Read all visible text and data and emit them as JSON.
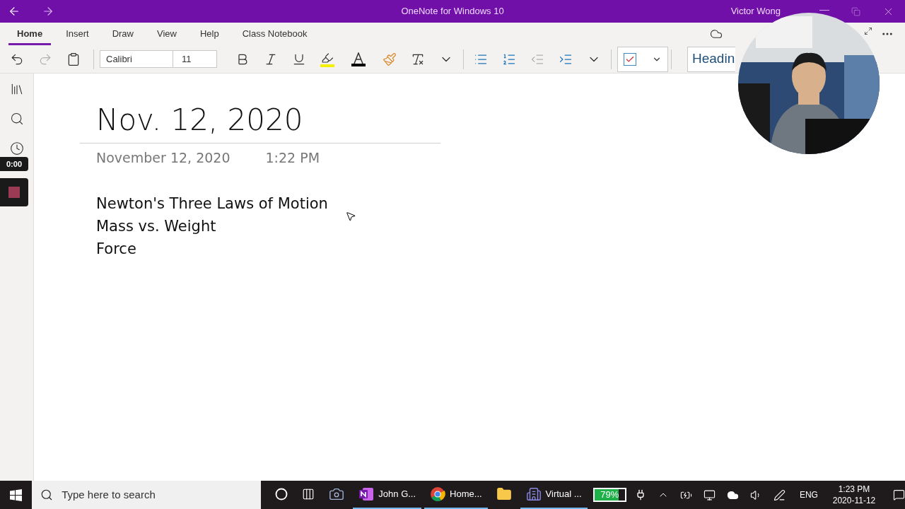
{
  "window": {
    "title": "OneNote for Windows 10",
    "user": "Victor Wong"
  },
  "ribbon_tabs": [
    {
      "label": "Home",
      "selected": true
    },
    {
      "label": "Insert",
      "selected": false
    },
    {
      "label": "Draw",
      "selected": false
    },
    {
      "label": "View",
      "selected": false
    },
    {
      "label": "Help",
      "selected": false
    },
    {
      "label": "Class Notebook",
      "selected": false
    }
  ],
  "toolbar": {
    "font": "Calibri",
    "size": "11",
    "style": "Headin",
    "history": [
      {
        "kind": "undo",
        "disabled": false
      },
      {
        "kind": "redo",
        "disabled": true
      },
      {
        "kind": "paste",
        "disabled": false
      }
    ],
    "formatting": [
      {
        "kind": "bold",
        "disabled": false
      },
      {
        "kind": "italic",
        "disabled": false
      },
      {
        "kind": "underline",
        "disabled": false
      },
      {
        "kind": "highlight",
        "disabled": false
      },
      {
        "kind": "font-color",
        "disabled": false
      },
      {
        "kind": "format-painter",
        "disabled": false
      },
      {
        "kind": "clear-format",
        "disabled": false
      },
      {
        "kind": "more",
        "disabled": false
      }
    ],
    "paragraph": [
      {
        "kind": "bullets",
        "disabled": false
      },
      {
        "kind": "numbering",
        "disabled": false
      },
      {
        "kind": "outdent",
        "disabled": true
      },
      {
        "kind": "indent",
        "disabled": false
      },
      {
        "kind": "more",
        "disabled": false
      }
    ],
    "tag": {
      "checked": true
    }
  },
  "recorder": {
    "time": "0:00"
  },
  "page": {
    "title": "Nov. 12, 2020",
    "date": "November 12, 2020",
    "time": "1:22 PM",
    "lines": [
      "Newton's Three Laws of Motion",
      "Mass vs. Weight",
      "Force"
    ]
  },
  "taskbar": {
    "search_placeholder": "Type here to search",
    "apps": [
      {
        "kind": "cortana",
        "running": false
      },
      {
        "kind": "task-view",
        "running": false
      },
      {
        "kind": "camera",
        "running": false
      },
      {
        "kind": "onenote",
        "label": "John G...",
        "running": true
      },
      {
        "kind": "chrome",
        "label": "Home...",
        "running": true
      },
      {
        "kind": "explorer",
        "running": false
      },
      {
        "kind": "virtual",
        "label": "Virtual ...",
        "running": true
      }
    ],
    "battery": {
      "level": 0.79,
      "reading": "79%"
    },
    "language": "ENG",
    "time": "1:23 PM",
    "date": "2020-11-12"
  }
}
